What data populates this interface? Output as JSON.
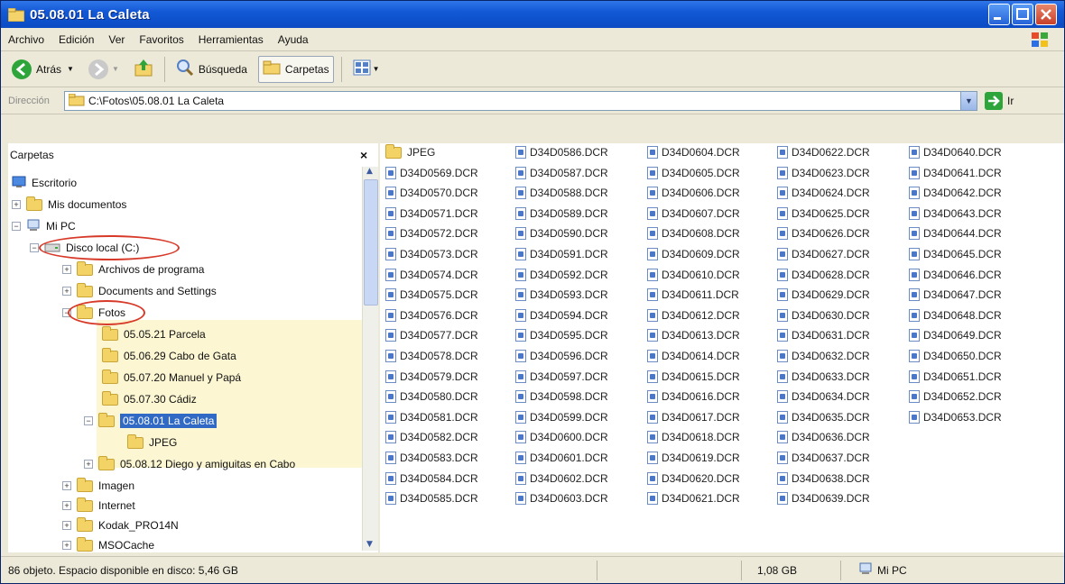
{
  "window": {
    "title": "05.08.01 La Caleta"
  },
  "menu": [
    "Archivo",
    "Edición",
    "Ver",
    "Favoritos",
    "Herramientas",
    "Ayuda"
  ],
  "toolbar": {
    "back": "Atrás",
    "search": "Búsqueda",
    "folders": "Carpetas"
  },
  "address": {
    "label": "Dirección",
    "value": "C:\\Fotos\\05.08.01 La Caleta",
    "go": "Ir"
  },
  "folders_pane": {
    "title": "Carpetas",
    "close": "×",
    "tree": [
      {
        "label": "Escritorio"
      },
      {
        "label": "Mis documentos"
      },
      {
        "label": "Mi PC"
      },
      {
        "label": "Disco local (C:)"
      },
      {
        "label": "Archivos de programa"
      },
      {
        "label": "Documents and Settings"
      },
      {
        "label": "Fotos"
      },
      {
        "label": "05.05.21 Parcela"
      },
      {
        "label": "05.06.29 Cabo de Gata"
      },
      {
        "label": "05.07.20 Manuel y Papá"
      },
      {
        "label": "05.07.30 Cádiz"
      },
      {
        "label": "05.08.01 La Caleta"
      },
      {
        "label": "JPEG"
      },
      {
        "label": "05.08.12 Diego y amiguitas en Cabo"
      },
      {
        "label": "Imagen"
      },
      {
        "label": "Internet"
      },
      {
        "label": "Kodak_PRO14N"
      },
      {
        "label": "MSOCache"
      }
    ]
  },
  "files": [
    [
      "JPEG",
      "D34D0569.DCR",
      "D34D0570.DCR",
      "D34D0571.DCR",
      "D34D0572.DCR",
      "D34D0573.DCR",
      "D34D0574.DCR",
      "D34D0575.DCR",
      "D34D0576.DCR",
      "D34D0577.DCR",
      "D34D0578.DCR",
      "D34D0579.DCR",
      "D34D0580.DCR",
      "D34D0581.DCR",
      "D34D0582.DCR",
      "D34D0583.DCR",
      "D34D0584.DCR",
      "D34D0585.DCR"
    ],
    [
      "D34D0586.DCR",
      "D34D0587.DCR",
      "D34D0588.DCR",
      "D34D0589.DCR",
      "D34D0590.DCR",
      "D34D0591.DCR",
      "D34D0592.DCR",
      "D34D0593.DCR",
      "D34D0594.DCR",
      "D34D0595.DCR",
      "D34D0596.DCR",
      "D34D0597.DCR",
      "D34D0598.DCR",
      "D34D0599.DCR",
      "D34D0600.DCR",
      "D34D0601.DCR",
      "D34D0602.DCR",
      "D34D0603.DCR"
    ],
    [
      "D34D0604.DCR",
      "D34D0605.DCR",
      "D34D0606.DCR",
      "D34D0607.DCR",
      "D34D0608.DCR",
      "D34D0609.DCR",
      "D34D0610.DCR",
      "D34D0611.DCR",
      "D34D0612.DCR",
      "D34D0613.DCR",
      "D34D0614.DCR",
      "D34D0615.DCR",
      "D34D0616.DCR",
      "D34D0617.DCR",
      "D34D0618.DCR",
      "D34D0619.DCR",
      "D34D0620.DCR",
      "D34D0621.DCR"
    ],
    [
      "D34D0622.DCR",
      "D34D0623.DCR",
      "D34D0624.DCR",
      "D34D0625.DCR",
      "D34D0626.DCR",
      "D34D0627.DCR",
      "D34D0628.DCR",
      "D34D0629.DCR",
      "D34D0630.DCR",
      "D34D0631.DCR",
      "D34D0632.DCR",
      "D34D0633.DCR",
      "D34D0634.DCR",
      "D34D0635.DCR",
      "D34D0636.DCR",
      "D34D0637.DCR",
      "D34D0638.DCR",
      "D34D0639.DCR"
    ],
    [
      "D34D0640.DCR",
      "D34D0641.DCR",
      "D34D0642.DCR",
      "D34D0643.DCR",
      "D34D0644.DCR",
      "D34D0645.DCR",
      "D34D0646.DCR",
      "D34D0647.DCR",
      "D34D0648.DCR",
      "D34D0649.DCR",
      "D34D0650.DCR",
      "D34D0651.DCR",
      "D34D0652.DCR",
      "D34D0653.DCR"
    ]
  ],
  "status": {
    "objects": "86 objeto. Espacio disponible en disco: 5,46 GB",
    "size": "1,08 GB",
    "location": "Mi PC"
  },
  "colors": {
    "titlebar": "#1258d6",
    "highlight_ring": "#d83a2a",
    "selection": "#316ac5"
  }
}
